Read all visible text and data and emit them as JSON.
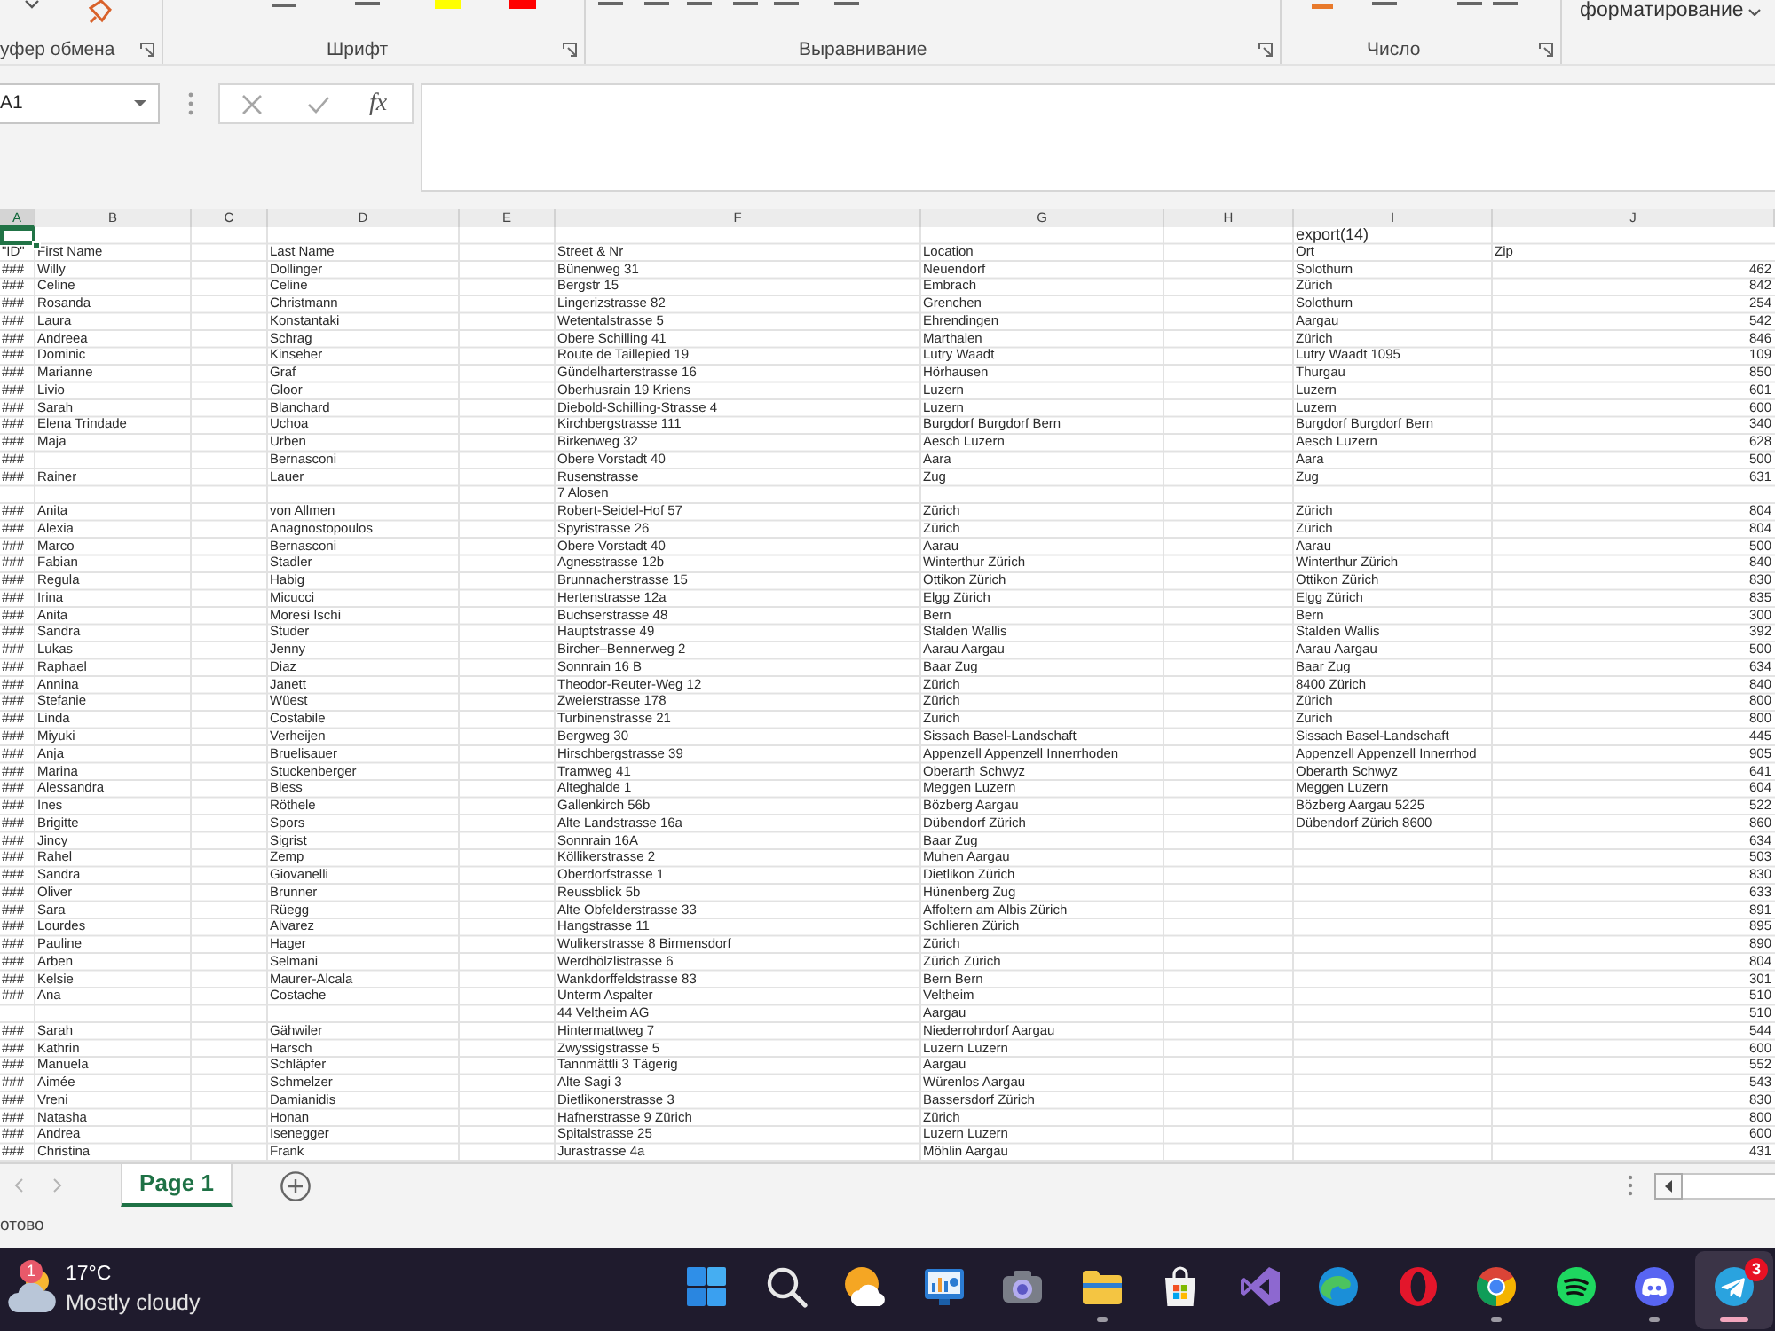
{
  "ribbon": {
    "groups": [
      {
        "label": "уфер обмена"
      },
      {
        "label": "Шрифт"
      },
      {
        "label": "Выравнивание"
      },
      {
        "label": "Число"
      }
    ],
    "styles_button": "форматирование"
  },
  "formula_bar": {
    "name_box": "A1",
    "function_button": "fx"
  },
  "sheet": {
    "columns": [
      {
        "label": "A",
        "selected": true
      },
      {
        "label": "B",
        "selected": false
      },
      {
        "label": "C",
        "selected": false
      },
      {
        "label": "D",
        "selected": false
      },
      {
        "label": "E",
        "selected": false
      },
      {
        "label": "F",
        "selected": false
      },
      {
        "label": "G",
        "selected": false
      },
      {
        "label": "H",
        "selected": false
      },
      {
        "label": "I",
        "selected": false
      },
      {
        "label": "J",
        "selected": false,
        "numeric": true
      }
    ],
    "rows": [
      {
        "kind": "title",
        "selected": true,
        "cells": {
          "I": "export(14)"
        }
      },
      {
        "kind": "header",
        "selected": false,
        "cells": {
          "A": "\"ID\"",
          "B": "First Name",
          "D": "Last Name",
          "F": "Street & Nr",
          "G": "Location",
          "I": "Ort",
          "J": "Zip"
        }
      },
      {
        "kind": "data",
        "selected": false,
        "cells": {
          "A": "###",
          "B": "Willy",
          "D": "Dollinger",
          "F": "Bünenweg 31",
          "G": "Neuendorf",
          "I": "Solothurn",
          "J": "462"
        }
      },
      {
        "kind": "data",
        "selected": false,
        "cells": {
          "A": "###",
          "B": "Celine",
          "D": "Celine",
          "F": "Bergstr 15",
          "G": "Embrach",
          "I": "Zürich",
          "J": "842"
        }
      },
      {
        "kind": "data",
        "selected": false,
        "cells": {
          "A": "###",
          "B": "Rosanda",
          "D": "Christmann",
          "F": "Lingerizstrasse 82",
          "G": "Grenchen",
          "I": "Solothurn",
          "J": "254"
        }
      },
      {
        "kind": "data",
        "selected": false,
        "cells": {
          "A": "###",
          "B": "Laura",
          "D": "Konstantaki",
          "F": "Wetentalstrasse 5",
          "G": "Ehrendingen",
          "I": "Aargau",
          "J": "542"
        }
      },
      {
        "kind": "data",
        "selected": false,
        "cells": {
          "A": "###",
          "B": "Andreea",
          "D": "Schrag",
          "F": "Obere Schilling 41",
          "G": "Marthalen",
          "I": "Zürich",
          "J": "846"
        }
      },
      {
        "kind": "data",
        "selected": false,
        "cells": {
          "A": "###",
          "B": "Dominic",
          "D": "Kinseher",
          "F": "Route de Taillepied 19",
          "G": "Lutry Waadt",
          "I": "Lutry Waadt 1095",
          "J": "109"
        }
      },
      {
        "kind": "data",
        "selected": false,
        "cells": {
          "A": "###",
          "B": "Marianne",
          "D": "Graf",
          "F": "Gündelharterstrasse 16",
          "G": "Hörhausen",
          "I": "Thurgau",
          "J": "850"
        }
      },
      {
        "kind": "data",
        "selected": false,
        "cells": {
          "A": "###",
          "B": "Livio",
          "D": "Gloor",
          "F": "Oberhusrain 19 Kriens",
          "G": "Luzern",
          "I": "Luzern",
          "J": "601"
        }
      },
      {
        "kind": "data",
        "selected": false,
        "cells": {
          "A": "###",
          "B": "Sarah",
          "D": "Blanchard",
          "F": "Diebold-Schilling-Strasse 4",
          "G": "Luzern",
          "I": "Luzern",
          "J": "600"
        }
      },
      {
        "kind": "data",
        "selected": false,
        "cells": {
          "A": "###",
          "B": "Elena Trindade",
          "D": "Uchoa",
          "F": "Kirchbergstrasse 111",
          "G": "Burgdorf Burgdorf Bern",
          "I": "Burgdorf Burgdorf Bern",
          "J": "340"
        }
      },
      {
        "kind": "data",
        "selected": false,
        "cells": {
          "A": "###",
          "B": "Maja",
          "D": "Urben",
          "F": "Birkenweg 32",
          "G": "Aesch Luzern",
          "I": "Aesch Luzern",
          "J": "628"
        }
      },
      {
        "kind": "data",
        "selected": false,
        "cells": {
          "A": "###",
          "D": "Bernasconi",
          "F": "Obere Vorstadt 40",
          "G": "Aara",
          "I": "Aara",
          "J": "500"
        }
      },
      {
        "kind": "data",
        "selected": false,
        "cells": {
          "A": "###",
          "B": "Rainer",
          "D": "Lauer",
          "F": "Rusenstrasse",
          "G": "Zug",
          "I": "Zug",
          "J": "631"
        }
      },
      {
        "kind": "data",
        "selected": false,
        "cells": {
          "F": "7 Alosen"
        }
      },
      {
        "kind": "data",
        "selected": false,
        "cells": {
          "A": "###",
          "B": "Anita",
          "D": "von Allmen",
          "F": "Robert-Seidel-Hof 57",
          "G": "Zürich",
          "I": "Zürich",
          "J": "804"
        }
      },
      {
        "kind": "data",
        "selected": false,
        "cells": {
          "A": "###",
          "B": "Alexia",
          "D": "Anagnostopoulos",
          "F": "Spyristrasse 26",
          "G": "Zürich",
          "I": "Zürich",
          "J": "804"
        }
      },
      {
        "kind": "data",
        "selected": false,
        "cells": {
          "A": "###",
          "B": "Marco",
          "D": "Bernasconi",
          "F": "Obere Vorstadt 40",
          "G": "Aarau",
          "I": "Aarau",
          "J": "500"
        }
      },
      {
        "kind": "data",
        "selected": false,
        "cells": {
          "A": "###",
          "B": "Fabian",
          "D": "Stadler",
          "F": "Agnesstrasse 12b",
          "G": "Winterthur Zürich",
          "I": "Winterthur Zürich",
          "J": "840"
        }
      },
      {
        "kind": "data",
        "selected": false,
        "cells": {
          "A": "###",
          "B": "Regula",
          "D": "Habig",
          "F": "Brunnacherstrasse 15",
          "G": "Ottikon Zürich",
          "I": "Ottikon Zürich",
          "J": "830"
        }
      },
      {
        "kind": "data",
        "selected": false,
        "cells": {
          "A": "###",
          "B": "Irina",
          "D": "Micucci",
          "F": "Hertenstrasse 12a",
          "G": "Elgg Zürich",
          "I": "Elgg Zürich",
          "J": "835"
        }
      },
      {
        "kind": "data",
        "selected": false,
        "cells": {
          "A": "###",
          "B": "Anita",
          "D": "Moresi Ischi",
          "F": "Buchserstrasse 48",
          "G": "Bern",
          "I": "Bern",
          "J": "300"
        }
      },
      {
        "kind": "data",
        "selected": false,
        "cells": {
          "A": "###",
          "B": "Sandra",
          "D": "Studer",
          "F": "Hauptstrasse 49",
          "G": "Stalden Wallis",
          "I": "Stalden Wallis",
          "J": "392"
        }
      },
      {
        "kind": "data",
        "selected": false,
        "cells": {
          "A": "###",
          "B": "Lukas",
          "D": "Jenny",
          "F": "Bircher–Bennerweg 2",
          "G": "Aarau Aargau",
          "I": "Aarau Aargau",
          "J": "500"
        }
      },
      {
        "kind": "data",
        "selected": false,
        "cells": {
          "A": "###",
          "B": "Raphael",
          "D": "Diaz",
          "F": "Sonnrain 16 B",
          "G": "Baar Zug",
          "I": "Baar Zug",
          "J": "634"
        }
      },
      {
        "kind": "data",
        "selected": false,
        "cells": {
          "A": "###",
          "B": "Annina",
          "D": "Janett",
          "F": "Theodor-Reuter-Weg 12",
          "G": "Zürich",
          "I": "8400 Zürich",
          "J": "840"
        }
      },
      {
        "kind": "data",
        "selected": false,
        "cells": {
          "A": "###",
          "B": "Stefanie",
          "D": "Wüest",
          "F": "Zweierstrasse 178",
          "G": "Zürich",
          "I": "Zürich",
          "J": "800"
        }
      },
      {
        "kind": "data",
        "selected": false,
        "cells": {
          "A": "###",
          "B": "Linda",
          "D": "Costabile",
          "F": "Turbinenstrasse 21",
          "G": "Zurich",
          "I": "Zurich",
          "J": "800"
        }
      },
      {
        "kind": "data",
        "selected": false,
        "cells": {
          "A": "###",
          "B": "Miyuki",
          "D": "Verheijen",
          "F": "Bergweg 30",
          "G": "Sissach Basel-Landschaft",
          "I": "Sissach Basel-Landschaft",
          "J": "445"
        }
      },
      {
        "kind": "data",
        "selected": false,
        "cells": {
          "A": "###",
          "B": "Anja",
          "D": "Bruelisauer",
          "F": "Hirschbergstrasse 39",
          "G": "Appenzell Appenzell Innerrhoden",
          "I": "Appenzell Appenzell Innerrhod",
          "J": "905"
        }
      },
      {
        "kind": "data",
        "selected": false,
        "cells": {
          "A": "###",
          "B": "Marina",
          "D": "Stuckenberger",
          "F": "Tramweg 41",
          "G": "Oberarth Schwyz",
          "I": "Oberarth Schwyz",
          "J": "641"
        }
      },
      {
        "kind": "data",
        "selected": false,
        "cells": {
          "A": "###",
          "B": "Alessandra",
          "D": "Bless",
          "F": "Alteghalde 1",
          "G": "Meggen Luzern",
          "I": "Meggen Luzern",
          "J": "604"
        }
      },
      {
        "kind": "data",
        "selected": false,
        "cells": {
          "A": "###",
          "B": "Ines",
          "D": "Röthele",
          "F": "Gallenkirch 56b",
          "G": "Bözberg Aargau",
          "I": "Bözberg Aargau 5225",
          "J": "522"
        }
      },
      {
        "kind": "data",
        "selected": false,
        "cells": {
          "A": "###",
          "B": "Brigitte",
          "D": "Spors",
          "F": "Alte Landstrasse 16a",
          "G": "Dübendorf Zürich",
          "I": "Dübendorf Zürich 8600",
          "J": "860"
        }
      },
      {
        "kind": "data",
        "selected": false,
        "cells": {
          "A": "###",
          "B": "Jincy",
          "D": "Sigrist",
          "F": "Sonnrain 16A",
          "G": "Baar Zug",
          "J": "634"
        }
      },
      {
        "kind": "data",
        "selected": false,
        "cells": {
          "A": "###",
          "B": "Rahel",
          "D": "Zemp",
          "F": "Köllikerstrasse 2",
          "G": "Muhen Aargau",
          "J": "503"
        }
      },
      {
        "kind": "data",
        "selected": false,
        "cells": {
          "A": "###",
          "B": "Sandra",
          "D": "Giovanelli",
          "F": "Oberdorfstrasse 1",
          "G": "Dietlikon Zürich",
          "J": "830"
        }
      },
      {
        "kind": "data",
        "selected": false,
        "cells": {
          "A": "###",
          "B": "Oliver",
          "D": "Brunner",
          "F": "Reussblick 5b",
          "G": "Hünenberg Zug",
          "J": "633"
        }
      },
      {
        "kind": "data",
        "selected": false,
        "cells": {
          "A": "###",
          "B": "Sara",
          "D": "Rüegg",
          "F": "Alte Obfelderstrasse 33",
          "G": "Affoltern am Albis Zürich",
          "J": "891"
        }
      },
      {
        "kind": "data",
        "selected": false,
        "cells": {
          "A": "###",
          "B": "Lourdes",
          "D": "Alvarez",
          "F": "Hangstrasse 11",
          "G": "Schlieren Zürich",
          "J": "895"
        }
      },
      {
        "kind": "data",
        "selected": false,
        "cells": {
          "A": "###",
          "B": "Pauline",
          "D": "Hager",
          "F": "Wulikerstrasse 8 Birmensdorf",
          "G": "Zürich",
          "J": "890"
        }
      },
      {
        "kind": "data",
        "selected": false,
        "cells": {
          "A": "###",
          "B": "Arben",
          "D": "Selmani",
          "F": "Werdhölzlistrasse 6",
          "G": "Zürich Zürich",
          "J": "804"
        }
      },
      {
        "kind": "data",
        "selected": false,
        "cells": {
          "A": "###",
          "B": "Kelsie",
          "D": "Maurer-Alcala",
          "F": "Wankdorffeldstrasse 83",
          "G": "Bern Bern",
          "J": "301"
        }
      },
      {
        "kind": "data",
        "selected": false,
        "cells": {
          "A": "###",
          "B": "Ana",
          "D": "Costache",
          "F": "Unterm Aspalter",
          "G": "Veltheim",
          "J": "510"
        }
      },
      {
        "kind": "data",
        "selected": false,
        "cells": {
          "F": "44 Veltheim AG",
          "G": "Aargau",
          "J": "510"
        }
      },
      {
        "kind": "data",
        "selected": false,
        "cells": {
          "A": "###",
          "B": "Sarah",
          "D": "Gähwiler",
          "F": "Hintermattweg 7",
          "G": "Niederrohrdorf Aargau",
          "J": "544"
        }
      },
      {
        "kind": "data",
        "selected": false,
        "cells": {
          "A": "###",
          "B": "Kathrin",
          "D": "Harsch",
          "F": "Zwyssigstrasse 5",
          "G": "Luzern Luzern",
          "J": "600"
        }
      },
      {
        "kind": "data",
        "selected": false,
        "cells": {
          "A": "###",
          "B": "Manuela",
          "D": "Schläpfer",
          "F": "Tannmättli 3 Tägerig",
          "G": "Aargau",
          "J": "552"
        }
      },
      {
        "kind": "data",
        "selected": false,
        "cells": {
          "A": "###",
          "B": "Aimée",
          "D": "Schmelzer",
          "F": "Alte Sagi 3",
          "G": "Würenlos Aargau",
          "J": "543"
        }
      },
      {
        "kind": "data",
        "selected": false,
        "cells": {
          "A": "###",
          "B": "Vreni",
          "D": "Damianidis",
          "F": "Dietlikonerstrasse 3",
          "G": "Bassersdorf Zürich",
          "J": "830"
        }
      },
      {
        "kind": "data",
        "selected": false,
        "cells": {
          "A": "###",
          "B": "Natasha",
          "D": "Honan",
          "F": "Hafnerstrasse 9 Zürich",
          "G": "Zürich",
          "J": "800"
        }
      },
      {
        "kind": "data",
        "selected": false,
        "cells": {
          "A": "###",
          "B": "Andrea",
          "D": "Isenegger",
          "F": "Spitalstrasse 25",
          "G": "Luzern Luzern",
          "J": "600"
        }
      },
      {
        "kind": "data",
        "selected": false,
        "cells": {
          "A": "###",
          "B": "Christina",
          "D": "Frank",
          "F": "Jurastrasse 4a",
          "G": "Möhlin Aargau",
          "J": "431"
        }
      }
    ]
  },
  "sheet_tabs": [
    {
      "label": "Page 1",
      "selected": true
    }
  ],
  "status_bar": {
    "text": "отово"
  },
  "taskbar": {
    "weather": {
      "badge": "1",
      "temperature": "17°C",
      "condition": "Mostly cloudy"
    },
    "apps": [
      {
        "kind": "start",
        "running": false,
        "active": false
      },
      {
        "kind": "search",
        "running": false,
        "active": false
      },
      {
        "kind": "weather",
        "running": false,
        "active": false
      },
      {
        "kind": "whiteboard",
        "running": false,
        "active": false
      },
      {
        "kind": "camera",
        "running": false,
        "active": false
      },
      {
        "kind": "folder",
        "running": true,
        "active": false
      },
      {
        "kind": "store",
        "running": false,
        "active": false
      },
      {
        "kind": "loop",
        "running": false,
        "active": false
      },
      {
        "kind": "swirl",
        "running": false,
        "active": false
      },
      {
        "kind": "ring",
        "running": false,
        "active": false
      },
      {
        "kind": "wheel",
        "running": true,
        "active": false
      },
      {
        "kind": "waves",
        "running": false,
        "active": false
      },
      {
        "kind": "gamepad",
        "running": true,
        "active": false
      },
      {
        "kind": "plane",
        "running": true,
        "active": true,
        "badge": "3"
      }
    ]
  }
}
